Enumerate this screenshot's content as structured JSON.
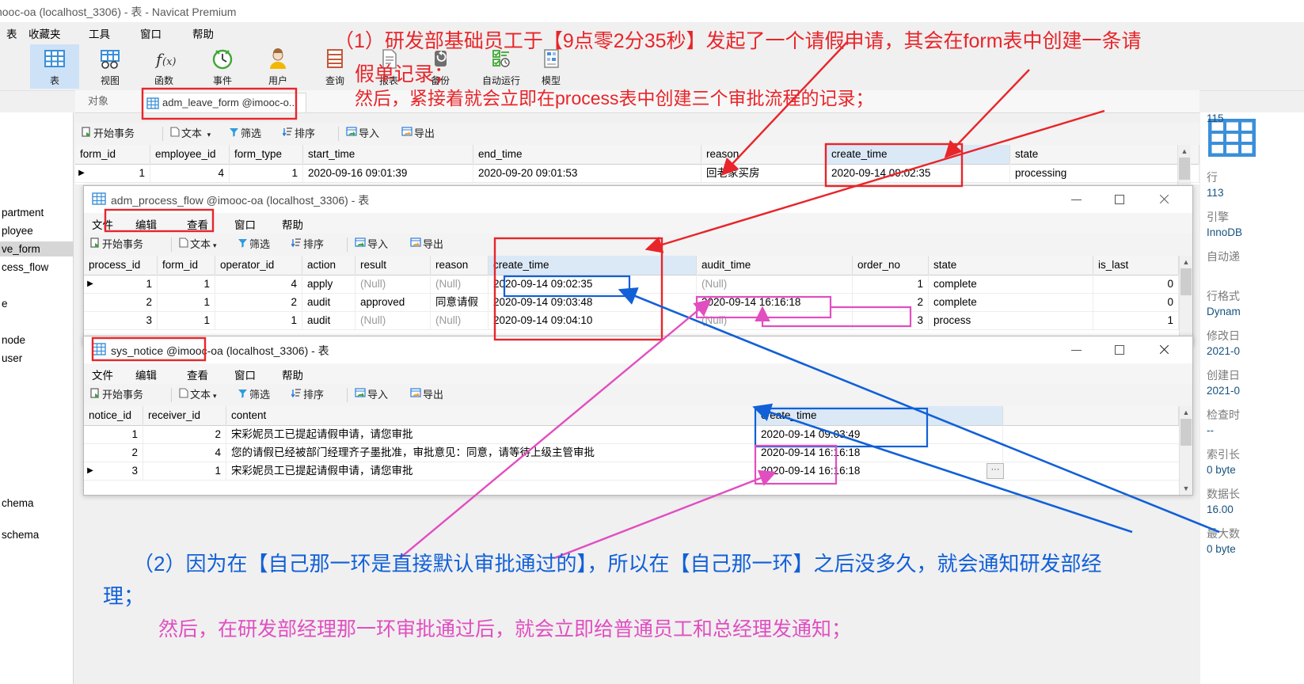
{
  "main_window": {
    "title": "imooc-oa (localhost_3306) - 表 - Navicat Premium",
    "menus": [
      "表",
      "收藏夹",
      "工具",
      "窗口",
      "帮助"
    ],
    "ribbon": [
      {
        "label": "表",
        "icon": "table-icon",
        "selected": true
      },
      {
        "label": "视图",
        "icon": "view-icon",
        "selected": false
      },
      {
        "label": "函数",
        "icon": "function-icon",
        "selected": false
      },
      {
        "label": "事件",
        "icon": "event-clock-icon",
        "selected": false
      },
      {
        "label": "用户",
        "icon": "user-icon",
        "selected": false
      },
      {
        "label": "查询",
        "icon": "query-icon",
        "selected": false
      },
      {
        "label": "报表",
        "icon": "report-icon",
        "selected": false
      },
      {
        "label": "备份",
        "icon": "backup-icon",
        "selected": false
      },
      {
        "label": "自动运行",
        "icon": "automation-icon",
        "selected": false
      },
      {
        "label": "模型",
        "icon": "model-icon",
        "selected": false
      }
    ],
    "object_bar": {
      "label": "对象",
      "tab": "adm_leave_form @imooc-o..."
    }
  },
  "left_tree": {
    "items": [
      {
        "label": "partment",
        "selected": false
      },
      {
        "label": "ployee",
        "selected": false
      },
      {
        "label": "ve_form",
        "selected": true
      },
      {
        "label": "cess_flow",
        "selected": false
      },
      {
        "label": "e",
        "selected": false
      },
      {
        "label": "node",
        "selected": false
      },
      {
        "label": "user",
        "selected": false
      },
      {
        "label": "chema",
        "selected": false
      },
      {
        "label": "schema",
        "selected": false
      }
    ]
  },
  "toolbar": {
    "begin_transaction": "开始事务",
    "text": "文本",
    "filter": "筛选",
    "sort": "排序",
    "import": "导入",
    "export": "导出"
  },
  "leave_form_grid": {
    "columns": [
      "form_id",
      "employee_id",
      "form_type",
      "start_time",
      "end_time",
      "reason",
      "create_time",
      "state"
    ],
    "highlight_column": "create_time",
    "rows": [
      {
        "form_id": "1",
        "employee_id": "4",
        "form_type": "1",
        "start_time": "2020-09-16 09:01:39",
        "end_time": "2020-09-20 09:01:53",
        "reason": "回老家买房",
        "create_time": "2020-09-14 09:02:35",
        "state": "processing"
      }
    ]
  },
  "process_flow_window": {
    "title": "adm_process_flow @imooc-oa (localhost_3306) - 表",
    "title_highlight": "adm_process_flow",
    "menus": [
      "文件",
      "编辑",
      "查看",
      "窗口",
      "帮助"
    ],
    "columns": [
      "process_id",
      "form_id",
      "operator_id",
      "action",
      "result",
      "reason",
      "create_time",
      "audit_time",
      "order_no",
      "state",
      "is_last"
    ],
    "highlight_column": "create_time",
    "rows": [
      {
        "process_id": "1",
        "form_id": "1",
        "operator_id": "4",
        "action": "apply",
        "result": "(Null)",
        "reason": "(Null)",
        "create_time": "2020-09-14 09:02:35",
        "audit_time": "(Null)",
        "order_no": "1",
        "state": "complete",
        "is_last": "0"
      },
      {
        "process_id": "2",
        "form_id": "1",
        "operator_id": "2",
        "action": "audit",
        "result": "approved",
        "reason": "同意请假",
        "create_time": "2020-09-14 09:03:48",
        "audit_time": "2020-09-14 16:16:18",
        "order_no": "2",
        "state": "complete",
        "is_last": "0"
      },
      {
        "process_id": "3",
        "form_id": "1",
        "operator_id": "1",
        "action": "audit",
        "result": "(Null)",
        "reason": "(Null)",
        "create_time": "2020-09-14 09:04:10",
        "audit_time": "(Null)",
        "order_no": "3",
        "state": "process",
        "is_last": "1"
      }
    ]
  },
  "notice_window": {
    "title": "sys_notice @imooc-oa (localhost_3306) - 表",
    "title_highlight": "sys_notice",
    "menus": [
      "文件",
      "编辑",
      "查看",
      "窗口",
      "帮助"
    ],
    "columns": [
      "notice_id",
      "receiver_id",
      "content",
      "create_time"
    ],
    "highlight_column": "create_time",
    "rows": [
      {
        "notice_id": "1",
        "receiver_id": "2",
        "content": "宋彩妮员工已提起请假申请，请您审批",
        "create_time": "2020-09-14 09:03:49"
      },
      {
        "notice_id": "2",
        "receiver_id": "4",
        "content": "您的请假已经被部门经理齐子墨批准，审批意见：同意，请等待上级主管审批",
        "create_time": "2020-09-14 16:16:18"
      },
      {
        "notice_id": "3",
        "receiver_id": "1",
        "content": "宋彩妮员工已提起请假申请，请您审批",
        "create_time": "2020-09-14 16:16:18"
      }
    ]
  },
  "right_panel": {
    "icon": "table-large-icon",
    "properties": [
      {
        "key": "行",
        "value": "113"
      },
      {
        "key": "引擎",
        "value": "InnoDB"
      },
      {
        "key": "自动递",
        "value": "115"
      },
      {
        "key": "行格式",
        "value": "Dynam"
      },
      {
        "key": "修改日",
        "value": "2021-0"
      },
      {
        "key": "创建日",
        "value": "2021-0"
      },
      {
        "key": "检查时",
        "value": "--"
      },
      {
        "key": "索引长",
        "value": "0 byte"
      },
      {
        "key": "数据长",
        "value": "16.00"
      },
      {
        "key": "最大数",
        "value": "0 byte"
      }
    ]
  },
  "annotations": {
    "red_line1": "（1）研发部基础员工于【9点零2分35秒】发起了一个请假申请，其会在form表中创建一条请",
    "red_line2": "假单记录；",
    "red_line3": "然后，紧接着就会立即在process表中创建三个审批流程的记录；",
    "blue_line1": "（2）因为在【自己那一环是直接默认审批通过的】，所以在【自己那一环】之后没多久，就会通知研发部经",
    "blue_line2": "理；",
    "magenta_line1": "然后，在研发部经理那一环审批通过后，就会立即给普通员工和总经理发通知；",
    "colors": {
      "red": "#e8252a",
      "blue": "#1160d8",
      "magenta": "#e14ec0"
    }
  }
}
